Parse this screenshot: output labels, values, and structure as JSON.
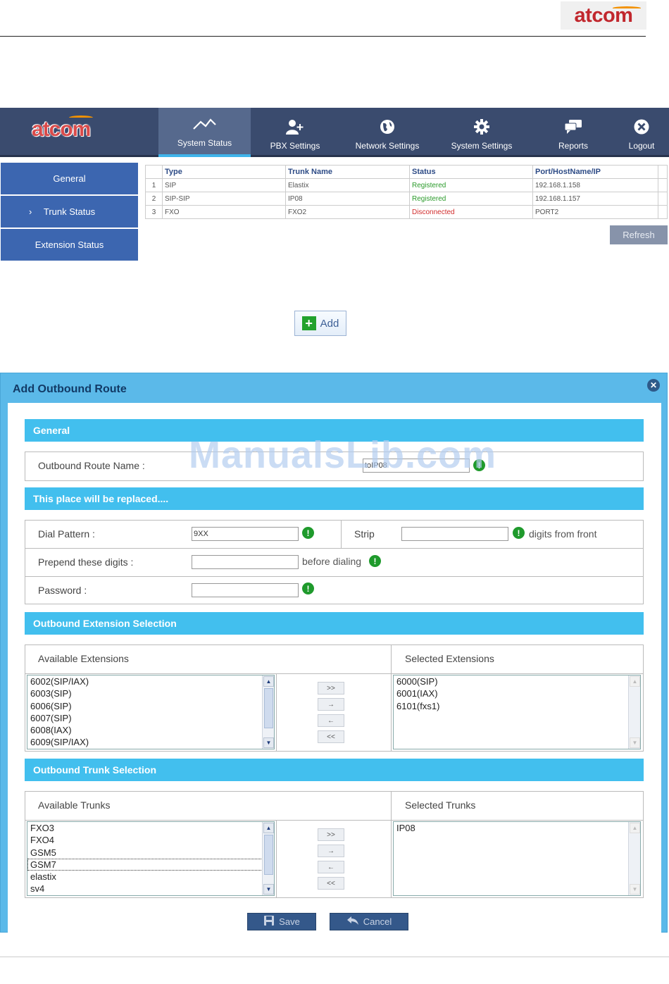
{
  "doc_header": {
    "brand": "atcom"
  },
  "topnav": {
    "brand": "atcom",
    "items": [
      {
        "label": "System Status",
        "icon": "chart-line-icon"
      },
      {
        "label": "PBX Settings",
        "icon": "user-add-icon"
      },
      {
        "label": "Network Settings",
        "icon": "globe-icon"
      },
      {
        "label": "System Settings",
        "icon": "gear-icon"
      },
      {
        "label": "Reports",
        "icon": "chat-icon"
      },
      {
        "label": "Logout",
        "icon": "close-circle-icon"
      }
    ],
    "active": "System Status"
  },
  "sidebar": {
    "items": [
      {
        "label": "General"
      },
      {
        "label": "Trunk Status",
        "chevron": "›"
      },
      {
        "label": "Extension Status"
      }
    ]
  },
  "trunk_table": {
    "headers": [
      "Type",
      "Trunk Name",
      "Status",
      "Port/HostName/IP"
    ],
    "rows": [
      {
        "num": "1",
        "type": "SIP",
        "name": "Elastix",
        "status": "Registered",
        "host": "192.168.1.158"
      },
      {
        "num": "2",
        "type": "SIP-SIP",
        "name": "IP08",
        "status": "Registered",
        "host": "192.168.1.157"
      },
      {
        "num": "3",
        "type": "FXO",
        "name": "FXO2",
        "status": "Disconnected",
        "host": "PORT2"
      }
    ],
    "refresh_label": "Refresh"
  },
  "add_button": {
    "label": "Add"
  },
  "dialog": {
    "title": "Add Outbound Route",
    "watermark": "ManualsLib.com",
    "sections": {
      "general": "General",
      "placeholder": "This place will be replaced....",
      "extension_selection": "Outbound Extension Selection",
      "trunk_selection": "Outbound Trunk Selection"
    },
    "route_name": {
      "label": "Outbound Route Name :",
      "value": "toIP08"
    },
    "dial_pattern": {
      "label": "Dial Pattern :",
      "value": "9XX"
    },
    "strip": {
      "label": "Strip",
      "value": "",
      "suffix": "digits from front"
    },
    "prepend": {
      "label": "Prepend these digits :",
      "value": "",
      "suffix": "before dialing"
    },
    "password": {
      "label": "Password :",
      "value": ""
    },
    "extensions": {
      "available_label": "Available Extensions",
      "selected_label": "Selected Extensions",
      "available": [
        "6002(SIP/IAX)",
        "6003(SIP)",
        "6006(SIP)",
        "6007(SIP)",
        "6008(IAX)",
        "6009(SIP/IAX)"
      ],
      "selected": [
        "6000(SIP)",
        "6001(IAX)",
        "6101(fxs1)"
      ]
    },
    "trunks": {
      "available_label": "Available Trunks",
      "selected_label": "Selected Trunks",
      "available": [
        "FXO3",
        "FXO4",
        "GSM5",
        "GSM7",
        "elastix",
        "sv4"
      ],
      "selected": [
        "IP08"
      ]
    },
    "move_buttons": [
      ">>",
      "→",
      "←",
      "<<"
    ],
    "save_label": "Save",
    "cancel_label": "Cancel"
  }
}
